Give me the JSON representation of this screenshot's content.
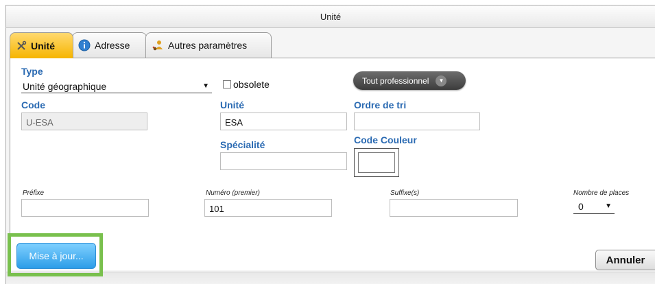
{
  "window": {
    "title": "Unité"
  },
  "tabs": [
    {
      "label": "Unité",
      "icon": "tools-icon",
      "active": true
    },
    {
      "label": "Adresse",
      "icon": "info-icon",
      "active": false
    },
    {
      "label": "Autres paramètres",
      "icon": "user-settings-icon",
      "active": false
    }
  ],
  "form": {
    "type_label": "Type",
    "type_value": "Unité géographique",
    "obsolete_label": "obsolete",
    "tout_label": "Tout professionnel",
    "code_label": "Code",
    "code_value": "U-ESA",
    "unite_label": "Unité",
    "unite_value": "ESA",
    "ordre_label": "Ordre de tri",
    "ordre_value": "",
    "specialite_label": "Spécialité",
    "specialite_value": "",
    "couleur_label": "Code Couleur",
    "prefixe_label": "Préfixe",
    "prefixe_value": "",
    "numero_label": "Numéro (premier)",
    "numero_value": "101",
    "suffixe_label": "Suffixe(s)",
    "suffixe_value": "",
    "places_label": "Nombre de places",
    "places_value": "0"
  },
  "buttons": {
    "mise_a_jour": "Mise à jour...",
    "annuler": "Annuler"
  },
  "colors": {
    "active_tab": "#f6b500",
    "label_blue": "#2a6ab2",
    "highlight_frame": "#79c04d",
    "primary_button": "#2c9de8"
  }
}
